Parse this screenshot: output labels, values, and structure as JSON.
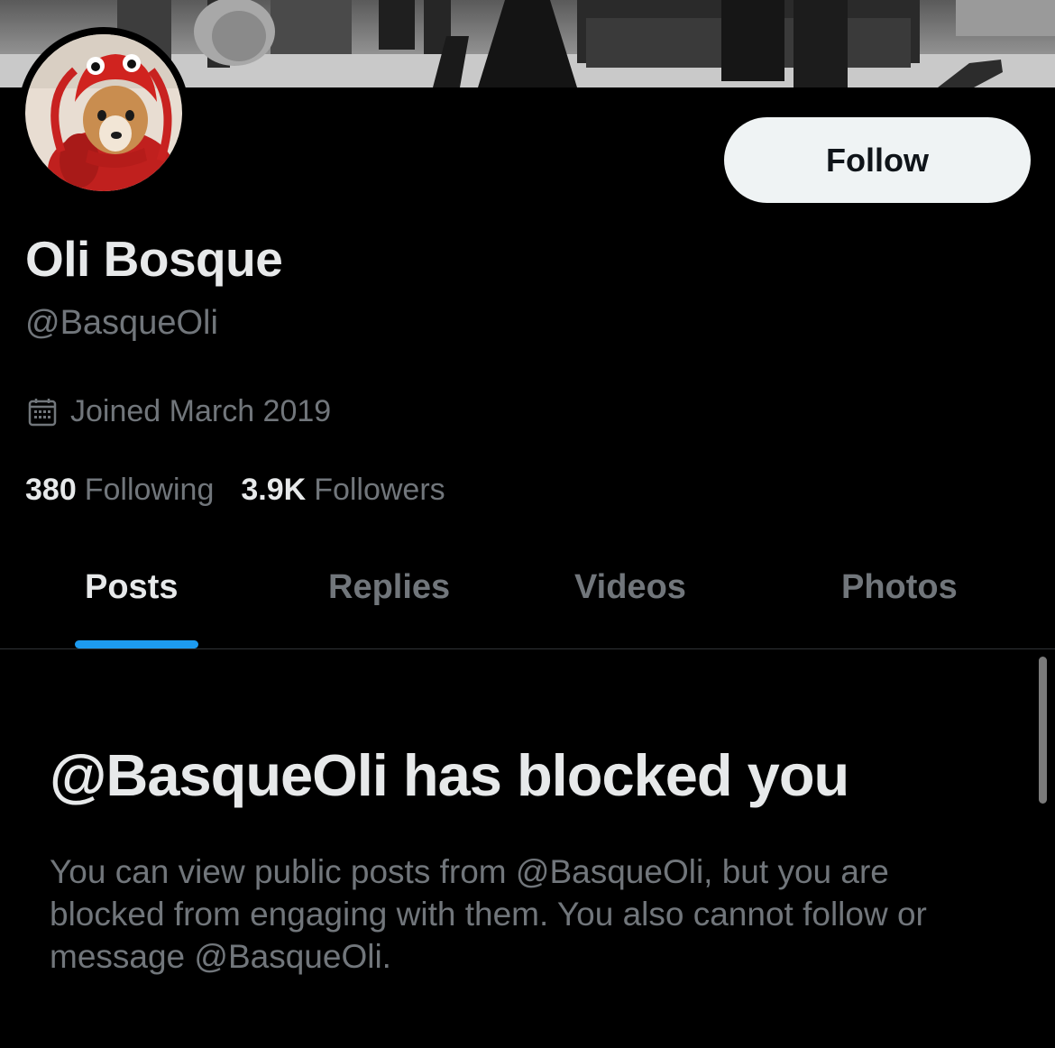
{
  "profile": {
    "display_name": "Oli Bosque",
    "handle": "@BasqueOli",
    "joined": "Joined March 2019",
    "follow_label": "Follow"
  },
  "stats": {
    "following_count": "380",
    "following_label": "Following",
    "followers_count": "3.9K",
    "followers_label": "Followers"
  },
  "tabs": [
    {
      "label": "Posts",
      "active": true
    },
    {
      "label": "Replies",
      "active": false
    },
    {
      "label": "Videos",
      "active": false
    },
    {
      "label": "Photos",
      "active": false
    }
  ],
  "blocked": {
    "title": "@BasqueOli has blocked you",
    "description": "You can view public posts from @BasqueOli, but you are blocked from engaging with them. You also cannot follow or message @BasqueOli."
  },
  "icons": {
    "calendar": "calendar-icon"
  },
  "colors": {
    "background": "#000000",
    "primary_text": "#e7e9ea",
    "secondary_text": "#71767b",
    "accent": "#1d9bf0",
    "follow_button_bg": "#eff3f4",
    "divider": "#2f3336"
  }
}
